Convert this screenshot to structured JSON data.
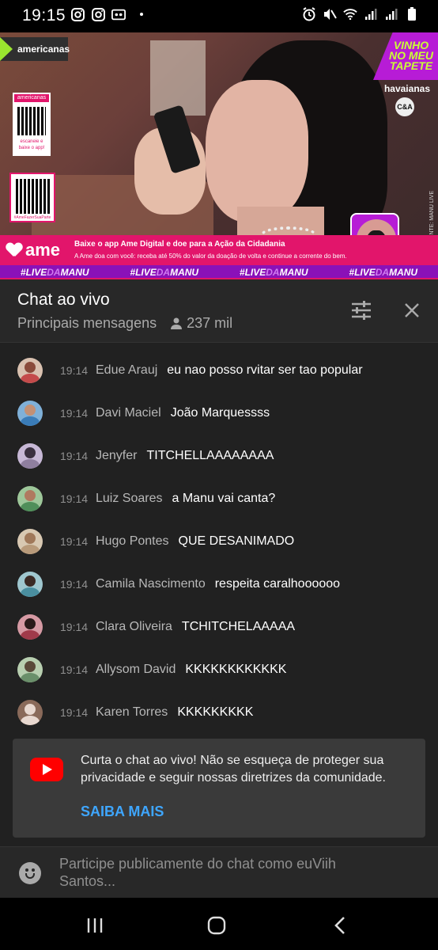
{
  "status_bar": {
    "time": "19:15"
  },
  "video": {
    "brand": "americanas",
    "qr1_top": "americanas",
    "qr1_bottom": "escaneie e baixe o app!",
    "qr2_bottom": "#AmeFazerSuaParte",
    "badge_text": "VINHO NO MEU TAPETE",
    "sponsor1": "havaianas",
    "sponsor2": "C&A",
    "side_text": "FONTE: MANU LIVE",
    "ame_logo": "ame",
    "ame_line1": "Baixe o app Ame Digital e doe para a Ação da Cidadania",
    "ame_line2": "A Ame doa com você: receba até 50% do valor da doação de volta e continue a corrente do bem.",
    "hashtags": [
      {
        "pre": "#LIVE",
        "mid": "DA",
        "post": "MANU"
      },
      {
        "pre": "#LIVE",
        "mid": "DA",
        "post": "MANU"
      },
      {
        "pre": "#LIVE",
        "mid": "DA",
        "post": "MANU"
      },
      {
        "pre": "#LIVE",
        "mid": "DA",
        "post": "MANU"
      }
    ]
  },
  "chat": {
    "title": "Chat ao vivo",
    "mode": "Principais mensagens",
    "viewers": "237 mil",
    "messages": [
      {
        "time": "19:14",
        "author": "Edue Arauj",
        "text": "eu nao posso rvitar ser tao popular",
        "avatar_color": "#c44b4b"
      },
      {
        "time": "19:14",
        "author": "Davi Maciel",
        "text": "João Marquessss",
        "avatar_color": "#3a7cb8"
      },
      {
        "time": "19:14",
        "author": "Jenyfer",
        "text": "TITCHELLAAAAAAAA",
        "avatar_color": "#8f7f9f"
      },
      {
        "time": "19:14",
        "author": "Luiz Soares",
        "text": "a Manu vai canta?",
        "avatar_color": "#4f8f5a"
      },
      {
        "time": "19:14",
        "author": "Hugo Pontes",
        "text": "QUE DESANIMADO",
        "avatar_color": "#b89a7a"
      },
      {
        "time": "19:14",
        "author": "Camila Nascimento",
        "text": "respeita caralhoooooo",
        "avatar_color": "#4a8fa0"
      },
      {
        "time": "19:14",
        "author": "Clara Oliveira",
        "text": "TCHITCHELAAAAA",
        "avatar_color": "#a03a4a"
      },
      {
        "time": "19:14",
        "author": "Allysom David",
        "text": "KKKKKKKKKKKK",
        "avatar_color": "#6a8f6a"
      },
      {
        "time": "19:14",
        "author": "Karen Torres",
        "text": "KKKKKKKKK",
        "avatar_color": "#8a6a5a"
      }
    ]
  },
  "notice": {
    "text": "Curta o chat ao vivo! Não se esqueça de proteger sua privacidade e seguir nossas diretrizes da comunidade.",
    "link": "SAIBA MAIS"
  },
  "input": {
    "placeholder": "Participe publicamente do chat como euViih Santos..."
  },
  "colors": {
    "accent_link": "#3ea6ff",
    "youtube_red": "#ff0000",
    "ame_pink": "#e2156b",
    "live_purple": "#8a11b8"
  }
}
